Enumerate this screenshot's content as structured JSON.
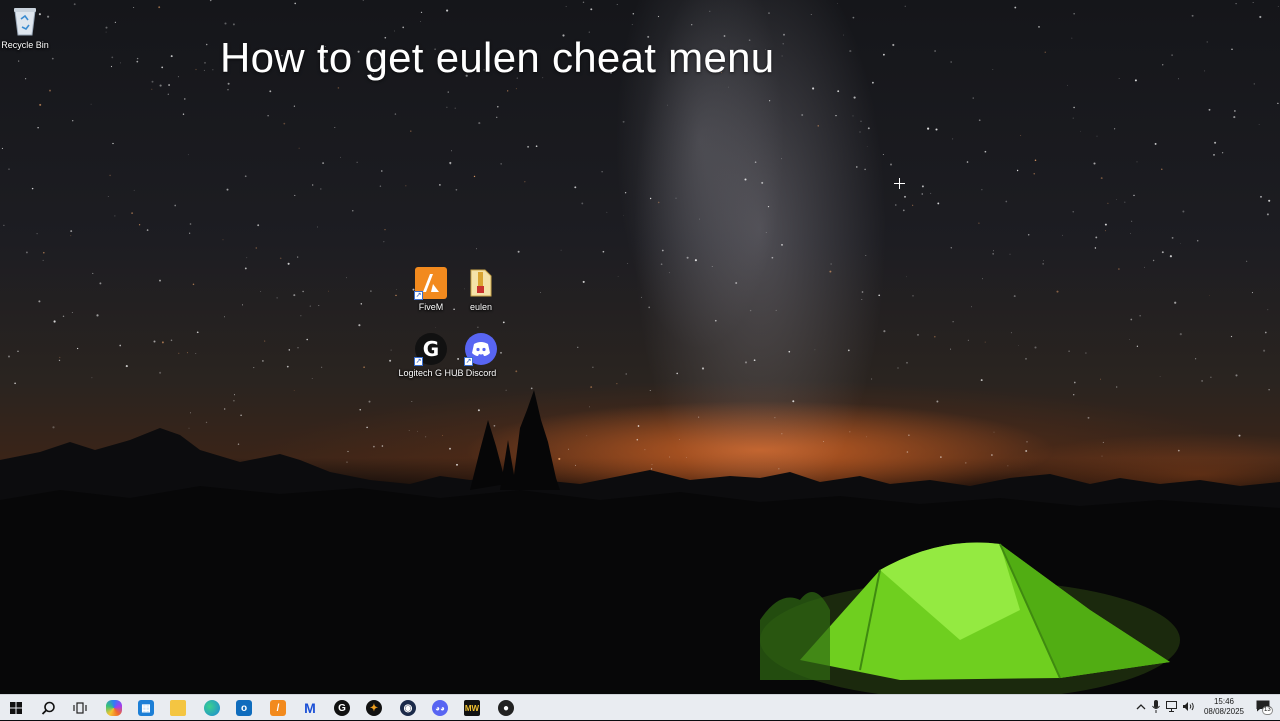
{
  "video_title": "How to get eulen cheat menu",
  "desktop": {
    "recycle_bin": {
      "label": "Recycle Bin",
      "icon": "recycle-bin-icon"
    },
    "icons": [
      {
        "label": "FiveM",
        "icon": "fivem-icon",
        "color": "#f28a1e"
      },
      {
        "label": "eulen",
        "icon": "zip-folder-icon",
        "color": "#f0c85a"
      },
      {
        "label": "Logitech G HUB",
        "icon": "logitech-g-hub-icon",
        "color": "#111111"
      },
      {
        "label": "Discord",
        "icon": "discord-icon",
        "color": "#5865f2"
      }
    ]
  },
  "taskbar": {
    "pinned": [
      {
        "name": "start",
        "icon": "windows-logo-icon"
      },
      {
        "name": "search",
        "icon": "search-icon"
      },
      {
        "name": "task-view",
        "icon": "task-view-icon"
      },
      {
        "name": "copilot",
        "icon": "copilot-icon"
      },
      {
        "name": "microsoft-store",
        "icon": "store-icon"
      },
      {
        "name": "file-explorer",
        "icon": "folder-icon"
      },
      {
        "name": "edge",
        "icon": "edge-icon"
      },
      {
        "name": "outlook",
        "icon": "outlook-icon"
      },
      {
        "name": "fivem",
        "icon": "fivem-icon"
      },
      {
        "name": "malwarebytes",
        "icon": "malwarebytes-icon"
      },
      {
        "name": "logitech-g-hub",
        "icon": "logitech-g-hub-icon"
      },
      {
        "name": "app",
        "icon": "compass-icon"
      },
      {
        "name": "steam",
        "icon": "steam-icon"
      },
      {
        "name": "discord",
        "icon": "discord-icon"
      },
      {
        "name": "mw",
        "icon": "mw-icon"
      },
      {
        "name": "obs",
        "icon": "obs-icon"
      }
    ],
    "tray": {
      "chevron": "chevron-up-icon",
      "mic": "microphone-icon",
      "network": "network-icon",
      "volume": "volume-icon",
      "time": "15:46",
      "date": "08/08/2025",
      "notifications_count": "13"
    }
  }
}
